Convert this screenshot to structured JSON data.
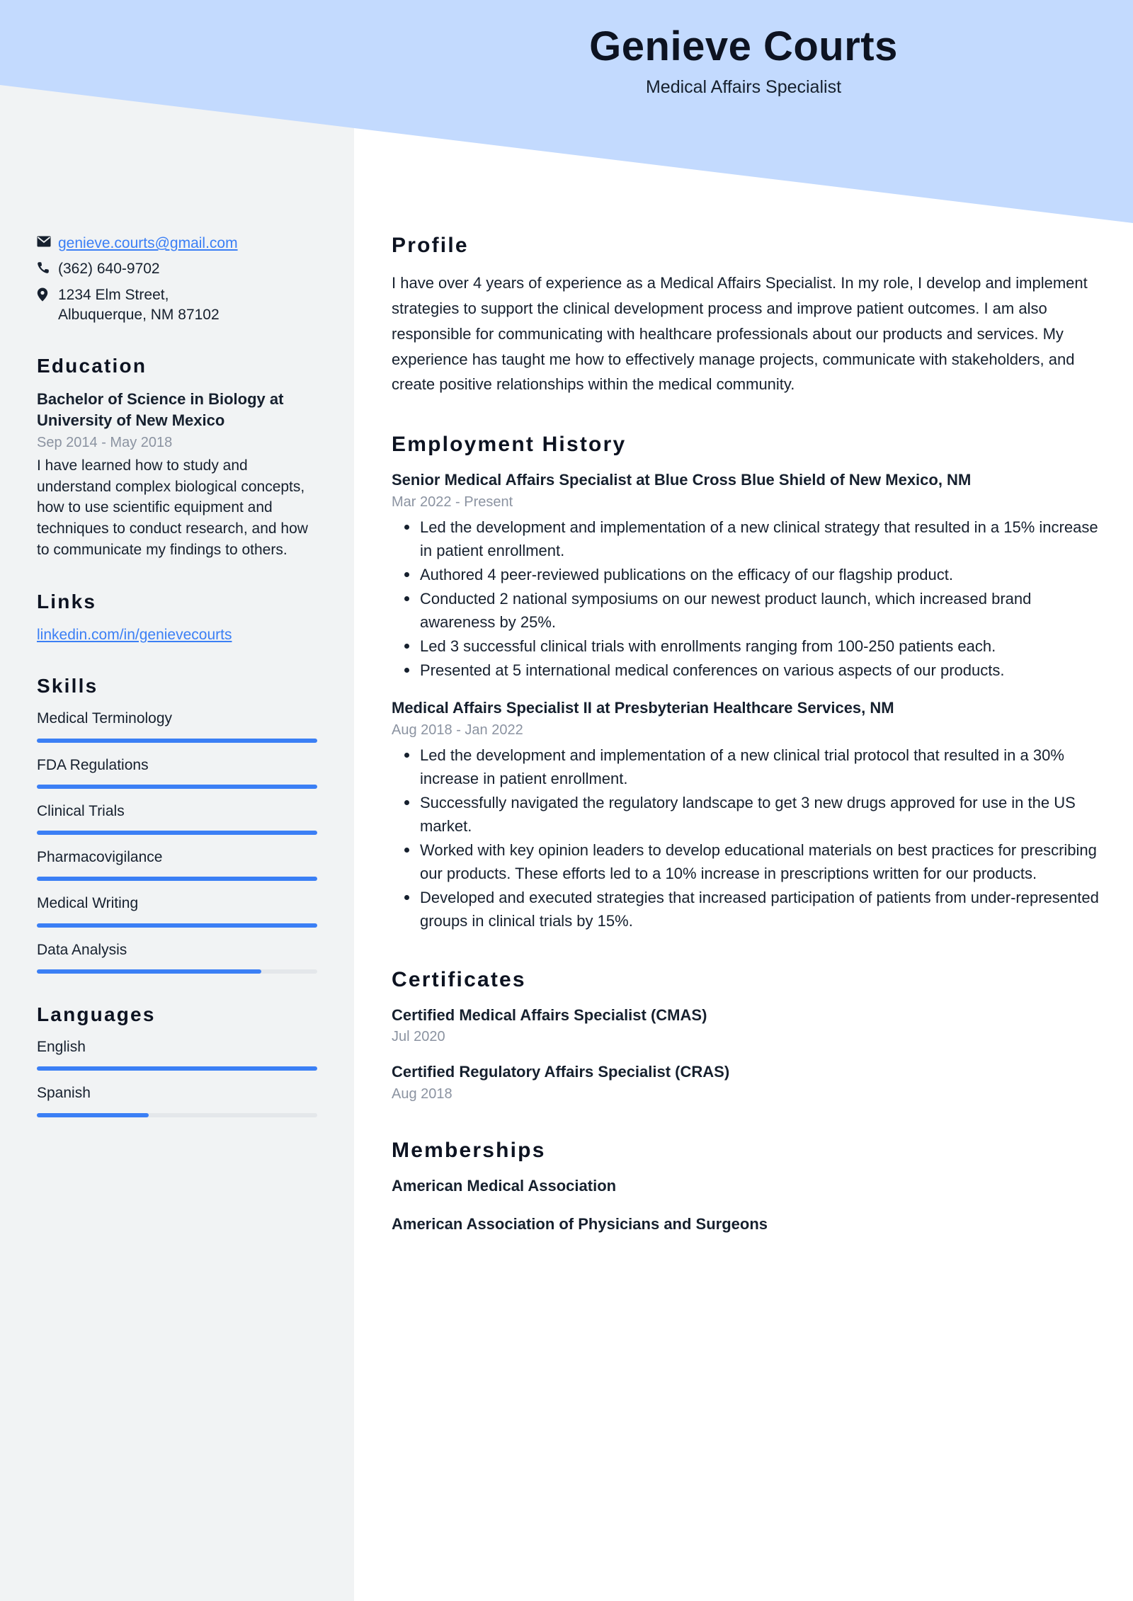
{
  "colors": {
    "banner": "#c3dafe",
    "sidebar": "#f1f3f4",
    "accent": "#3b7ff5",
    "text": "#16202e",
    "muted": "#8b93a1"
  },
  "header": {
    "name": "Genieve Courts",
    "job_title": "Medical Affairs Specialist"
  },
  "contact": {
    "email": "genieve.courts@gmail.com",
    "phone": "(362) 640-9702",
    "address_line1": "1234 Elm Street,",
    "address_line2": "Albuquerque, NM 87102"
  },
  "education": {
    "heading": "Education",
    "items": [
      {
        "title": "Bachelor of Science in Biology at University of New Mexico",
        "date": "Sep 2014 - May 2018",
        "description": "I have learned how to study and understand complex biological concepts, how to use scientific equipment and techniques to conduct research, and how to communicate my findings to others."
      }
    ]
  },
  "links": {
    "heading": "Links",
    "items": [
      {
        "label": "linkedin.com/in/genievecourts"
      }
    ]
  },
  "skills": {
    "heading": "Skills",
    "items": [
      {
        "label": "Medical Terminology",
        "level": 100
      },
      {
        "label": "FDA Regulations",
        "level": 100
      },
      {
        "label": "Clinical Trials",
        "level": 100
      },
      {
        "label": "Pharmacovigilance",
        "level": 100
      },
      {
        "label": "Medical Writing",
        "level": 100
      },
      {
        "label": "Data Analysis",
        "level": 80
      }
    ]
  },
  "languages": {
    "heading": "Languages",
    "items": [
      {
        "label": "English",
        "level": 100
      },
      {
        "label": "Spanish",
        "level": 40
      }
    ]
  },
  "profile": {
    "heading": "Profile",
    "text": "I have over 4 years of experience as a Medical Affairs Specialist. In my role, I develop and implement strategies to support the clinical development process and improve patient outcomes. I am also responsible for communicating with healthcare professionals about our products and services. My experience has taught me how to effectively manage projects, communicate with stakeholders, and create positive relationships within the medical community."
  },
  "employment": {
    "heading": "Employment History",
    "jobs": [
      {
        "title": "Senior Medical Affairs Specialist at Blue Cross Blue Shield of New Mexico, NM",
        "date": "Mar 2022 - Present",
        "bullets": [
          "Led the development and implementation of a new clinical strategy that resulted in a 15% increase in patient enrollment.",
          "Authored 4 peer-reviewed publications on the efficacy of our flagship product.",
          "Conducted 2 national symposiums on our newest product launch, which increased brand awareness by 25%.",
          "Led 3 successful clinical trials with enrollments ranging from 100-250 patients each.",
          "Presented at 5 international medical conferences on various aspects of our products."
        ]
      },
      {
        "title": "Medical Affairs Specialist II at Presbyterian Healthcare Services, NM",
        "date": "Aug 2018 - Jan 2022",
        "bullets": [
          "Led the development and implementation of a new clinical trial protocol that resulted in a 30% increase in patient enrollment.",
          "Successfully navigated the regulatory landscape to get 3 new drugs approved for use in the US market.",
          "Worked with key opinion leaders to develop educational materials on best practices for prescribing our products. These efforts led to a 10% increase in prescriptions written for our products.",
          "Developed and executed strategies that increased participation of patients from under-represented groups in clinical trials by 15%."
        ]
      }
    ]
  },
  "certificates": {
    "heading": "Certificates",
    "items": [
      {
        "title": "Certified Medical Affairs Specialist (CMAS)",
        "date": "Jul 2020"
      },
      {
        "title": "Certified Regulatory Affairs Specialist (CRAS)",
        "date": "Aug 2018"
      }
    ]
  },
  "memberships": {
    "heading": "Memberships",
    "items": [
      {
        "label": "American Medical Association"
      },
      {
        "label": "American Association of Physicians and Surgeons"
      }
    ]
  }
}
